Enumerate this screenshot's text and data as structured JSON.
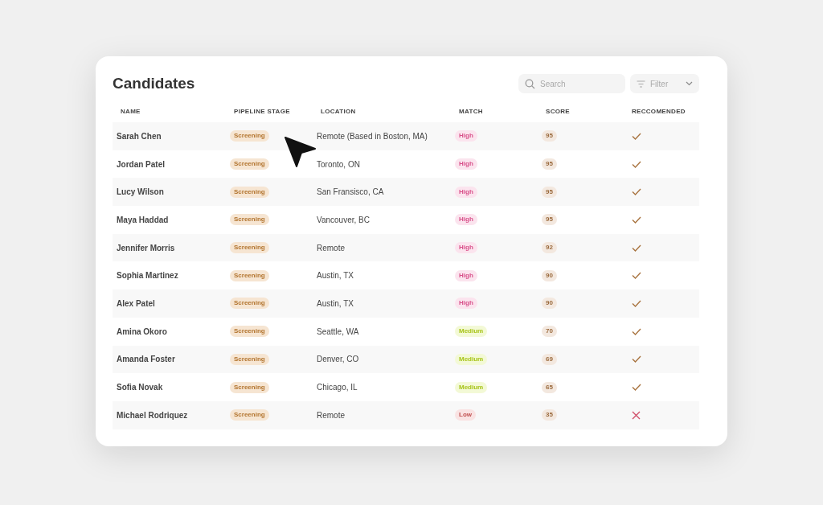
{
  "title": "Candidates",
  "search": {
    "placeholder": "Search"
  },
  "filter": {
    "placeholder": "Filter"
  },
  "columns": [
    "NAME",
    "PIPELINE STAGE",
    "LOCATION",
    "MATCH",
    "SCORE",
    "RECCOMENDED"
  ],
  "rows": [
    {
      "name": "Sarah Chen",
      "stage": "Screening",
      "location": "Remote (Based in Boston, MA)",
      "match": {
        "label": "High",
        "kind": "high"
      },
      "score": "95",
      "recommended": true
    },
    {
      "name": "Jordan Patel",
      "stage": "Screening",
      "location": "Toronto, ON",
      "match": {
        "label": "High",
        "kind": "high"
      },
      "score": "95",
      "recommended": true
    },
    {
      "name": "Lucy Wilson",
      "stage": "Screening",
      "location": "San Fransisco, CA",
      "match": {
        "label": "High",
        "kind": "high"
      },
      "score": "95",
      "recommended": true
    },
    {
      "name": "Maya Haddad",
      "stage": "Screening",
      "location": "Vancouver, BC",
      "match": {
        "label": "High",
        "kind": "high"
      },
      "score": "95",
      "recommended": true
    },
    {
      "name": "Jennifer Morris",
      "stage": "Screening",
      "location": "Remote",
      "match": {
        "label": "High",
        "kind": "high"
      },
      "score": "92",
      "recommended": true
    },
    {
      "name": "Sophia Martinez",
      "stage": "Screening",
      "location": "Austin, TX",
      "match": {
        "label": "High",
        "kind": "high"
      },
      "score": "90",
      "recommended": true
    },
    {
      "name": "Alex Patel",
      "stage": "Screening",
      "location": "Austin, TX",
      "match": {
        "label": "High",
        "kind": "high"
      },
      "score": "90",
      "recommended": true
    },
    {
      "name": "Amina Okoro",
      "stage": "Screening",
      "location": "Seattle, WA",
      "match": {
        "label": "Medium",
        "kind": "medium"
      },
      "score": "70",
      "recommended": true
    },
    {
      "name": "Amanda Foster",
      "stage": "Screening",
      "location": "Denver, CO",
      "match": {
        "label": "Medium",
        "kind": "medium"
      },
      "score": "69",
      "recommended": true
    },
    {
      "name": "Sofia Novak",
      "stage": "Screening",
      "location": "Chicago, IL",
      "match": {
        "label": "Medium",
        "kind": "medium"
      },
      "score": "65",
      "recommended": true
    },
    {
      "name": "Michael Rodriquez",
      "stage": "Screening",
      "location": "Remote",
      "match": {
        "label": "Low",
        "kind": "low"
      },
      "score": "35",
      "recommended": false
    }
  ]
}
